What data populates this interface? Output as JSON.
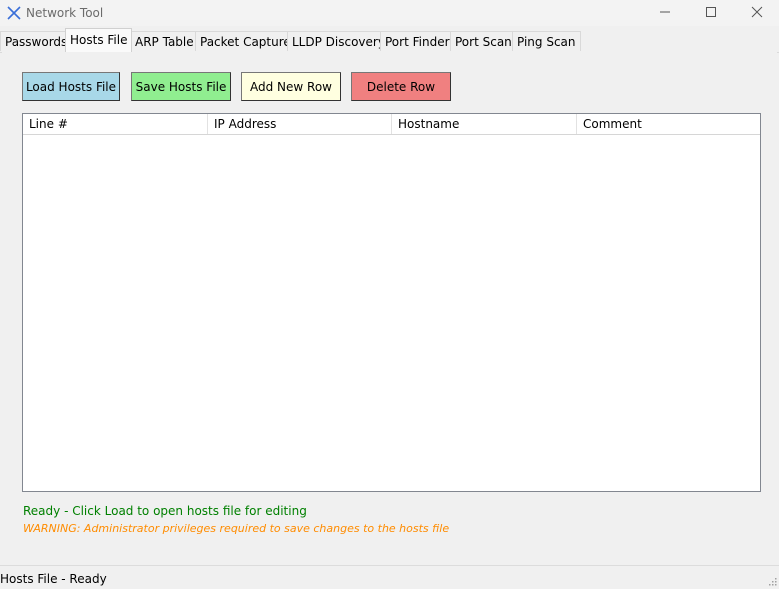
{
  "window": {
    "title": "Network Tool",
    "minimize_icon": "minimize-icon",
    "maximize_icon": "maximize-icon",
    "close_icon": "close-icon"
  },
  "tabs": [
    {
      "label": "Passwords",
      "active": false
    },
    {
      "label": "Hosts File",
      "active": true
    },
    {
      "label": "ARP Table",
      "active": false
    },
    {
      "label": "Packet Capture",
      "active": false
    },
    {
      "label": "LLDP Discovery",
      "active": false
    },
    {
      "label": "Port Finder",
      "active": false
    },
    {
      "label": "Port Scan",
      "active": false
    },
    {
      "label": "Ping Scan",
      "active": false
    }
  ],
  "toolbar": {
    "load_label": "Load Hosts File",
    "save_label": "Save Hosts File",
    "add_label": "Add New Row",
    "delete_label": "Delete Row"
  },
  "grid": {
    "columns": [
      "Line #",
      "IP Address",
      "Hostname",
      "Comment"
    ],
    "rows": []
  },
  "status": {
    "ready_message": "Ready - Click Load to open hosts file for editing",
    "warning_message": "WARNING: Administrator privileges required to save changes to the hosts file"
  },
  "statusbar": {
    "text": "Hosts File - Ready"
  },
  "colors": {
    "load_button": "#a8d8e8",
    "save_button": "#90ee90",
    "add_button": "#ffffe0",
    "delete_button": "#f08080",
    "ready_text": "#008000",
    "warning_text": "#ff8c00"
  }
}
